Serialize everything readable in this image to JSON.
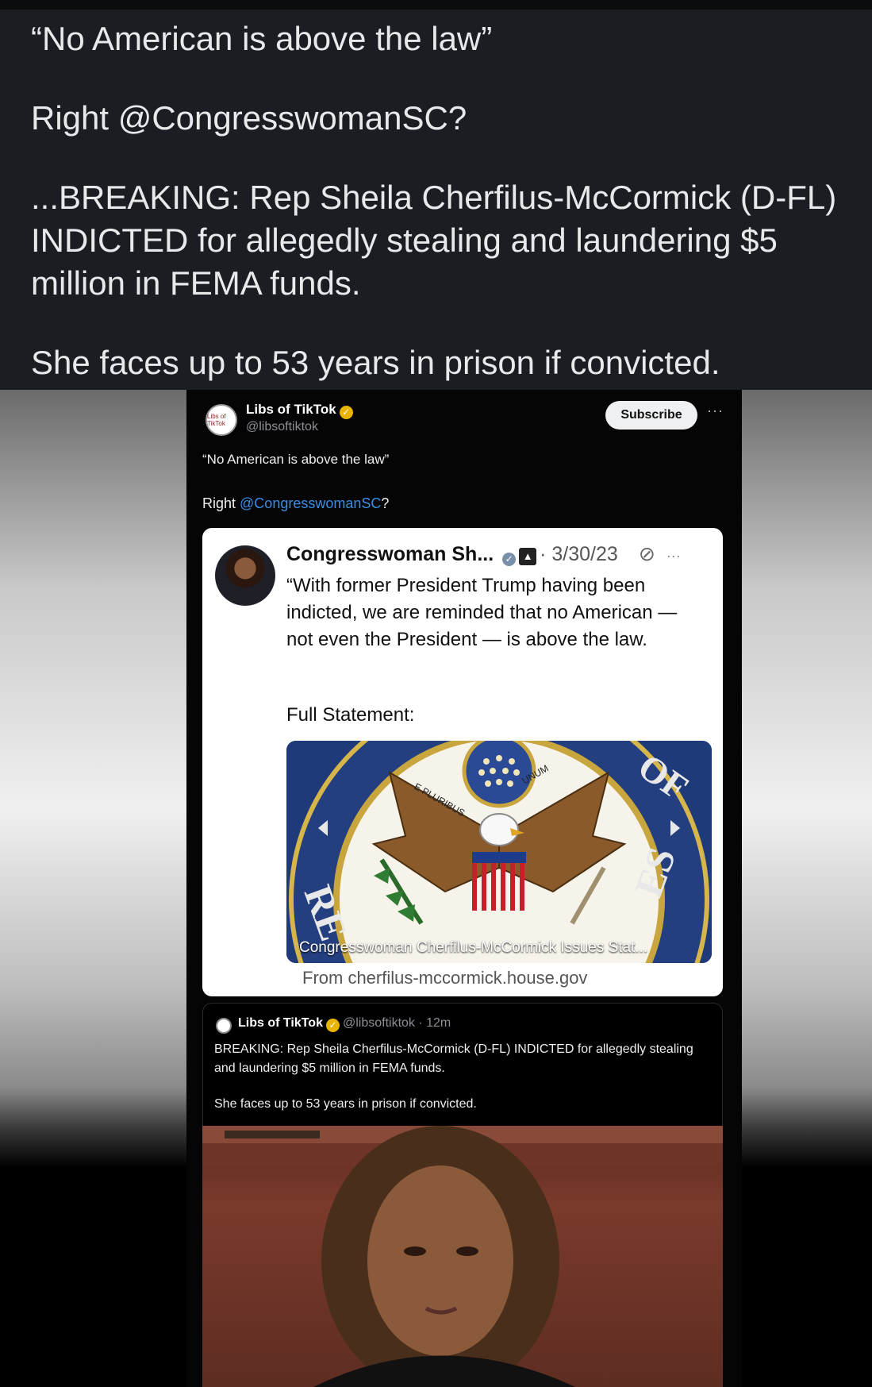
{
  "caption": {
    "line1": "“No American is above the law”",
    "line2": "Right @CongresswomanSC?",
    "line3": "...BREAKING: Rep Sheila Cherfilus-McCormick (D-FL) INDICTED for allegedly stealing and laundering $5 million in FEMA funds.",
    "line4": "She faces up to 53 years in prison if convicted."
  },
  "embedded_post": {
    "author_name": "Libs of TikTok",
    "author_handle": "@libsoftiktok",
    "avatar_text": "Libs of TikTok",
    "subscribe_label": "Subscribe",
    "more": "···",
    "text_line1": "“No American is above the law”",
    "text_right": "Right ",
    "mention": "@CongresswomanSC",
    "text_question": "?"
  },
  "quoted_tweet": {
    "name": "Congresswoman Sh...",
    "date": "· 3/30/23",
    "body": "“With former President Trump having been indicted, we are reminded that no American — not even the President — is above the law.",
    "full_statement": "Full Statement:",
    "link_title": "Congresswoman Cherfilus-McCormick Issues Stat...",
    "link_from": "From cherfilus-mccormick.house.gov",
    "seal_text_top": "OF",
    "seal_text_left": "RE",
    "seal_text_right": "ES",
    "seal_ribbon_left": "E PLURIBUS",
    "seal_ribbon_right": "UNUM"
  },
  "news_tweet": {
    "name": "Libs of TikTok",
    "handle_time": "@libsoftiktok · 12m",
    "body": "BREAKING: Rep Sheila Cherfilus-McCormick (D-FL) INDICTED for allegedly stealing and laundering $5 million in FEMA funds.",
    "body2": "She faces up to 53 years in prison if convicted."
  }
}
